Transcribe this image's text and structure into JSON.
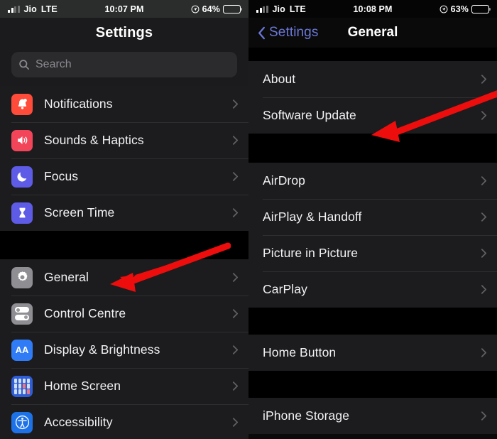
{
  "left_phone": {
    "status_bar": {
      "carrier": "Jio",
      "network": "LTE",
      "time": "10:07 PM",
      "battery_percent": "64%",
      "location_icon": "location-arrow-icon",
      "signal_icon": "cellular-bars-icon",
      "battery_icon": "battery-icon"
    },
    "nav": {
      "title": "Settings"
    },
    "search": {
      "placeholder": "Search",
      "icon": "search-icon"
    },
    "sections": [
      {
        "rows": [
          {
            "label": "Notifications",
            "icon": "bell-icon",
            "icon_color": "#ff4b3a"
          },
          {
            "label": "Sounds & Haptics",
            "icon": "speaker-icon",
            "icon_color": "#f3455a"
          },
          {
            "label": "Focus",
            "icon": "moon-icon",
            "icon_color": "#5e5ce6"
          },
          {
            "label": "Screen Time",
            "icon": "hourglass-icon",
            "icon_color": "#5e5ce6"
          }
        ]
      },
      {
        "rows": [
          {
            "label": "General",
            "icon": "gear-icon",
            "icon_color": "#8e8e93"
          },
          {
            "label": "Control Centre",
            "icon": "toggles-icon",
            "icon_color": "#8e8e93"
          },
          {
            "label": "Display & Brightness",
            "icon": "aa-icon",
            "icon_color": "#2f7cf6"
          },
          {
            "label": "Home Screen",
            "icon": "app-grid-icon",
            "icon_color": "#2f5ed6"
          },
          {
            "label": "Accessibility",
            "icon": "accessibility-icon",
            "icon_color": "#1e72e8"
          }
        ]
      }
    ]
  },
  "right_phone": {
    "status_bar": {
      "carrier": "Jio",
      "network": "LTE",
      "time": "10:08 PM",
      "battery_percent": "63%",
      "location_icon": "location-arrow-icon",
      "signal_icon": "cellular-bars-icon",
      "battery_icon": "battery-icon"
    },
    "nav": {
      "back_label": "Settings",
      "title": "General",
      "back_icon": "chevron-left-icon"
    },
    "sections": [
      {
        "rows": [
          {
            "label": "About"
          },
          {
            "label": "Software Update"
          }
        ]
      },
      {
        "rows": [
          {
            "label": "AirDrop"
          },
          {
            "label": "AirPlay & Handoff"
          },
          {
            "label": "Picture in Picture"
          },
          {
            "label": "CarPlay"
          }
        ]
      },
      {
        "rows": [
          {
            "label": "Home Button"
          }
        ]
      },
      {
        "rows": [
          {
            "label": "iPhone Storage"
          }
        ]
      }
    ]
  },
  "annotations": {
    "arrow_color": "#ee0d0d",
    "left_arrow": {
      "target": "General",
      "name": "red-arrow-general"
    },
    "right_arrow": {
      "target": "Software Update",
      "name": "red-arrow-software-update"
    }
  }
}
